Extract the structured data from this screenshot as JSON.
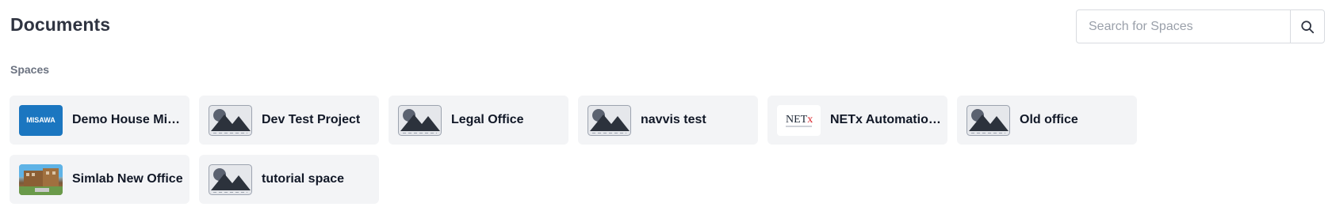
{
  "header": {
    "title": "Documents",
    "search_placeholder": "Search for Spaces",
    "search_icon": "search-icon"
  },
  "sections": {
    "spaces_label": "Spaces"
  },
  "spaces": [
    {
      "name": "Demo House Mis…",
      "thumb": "logo",
      "logo_text": "MISAWA"
    },
    {
      "name": "Dev Test Project",
      "thumb": "image-placeholder-icon"
    },
    {
      "name": "Legal Office",
      "thumb": "image-placeholder-icon"
    },
    {
      "name": "navvis test",
      "thumb": "image-placeholder-icon"
    },
    {
      "name": "NETx Automation…",
      "thumb": "logo",
      "logo_text": "NETx"
    },
    {
      "name": "Old office",
      "thumb": "image-placeholder-icon"
    },
    {
      "name": "Simlab New Office",
      "thumb": "photo"
    },
    {
      "name": "tutorial space",
      "thumb": "image-placeholder-icon"
    }
  ],
  "colors": {
    "card_bg": "#f3f4f6",
    "misawa_blue": "#1b76c0",
    "netx_red": "#d9232a",
    "placeholder_dark": "#2c323c"
  }
}
